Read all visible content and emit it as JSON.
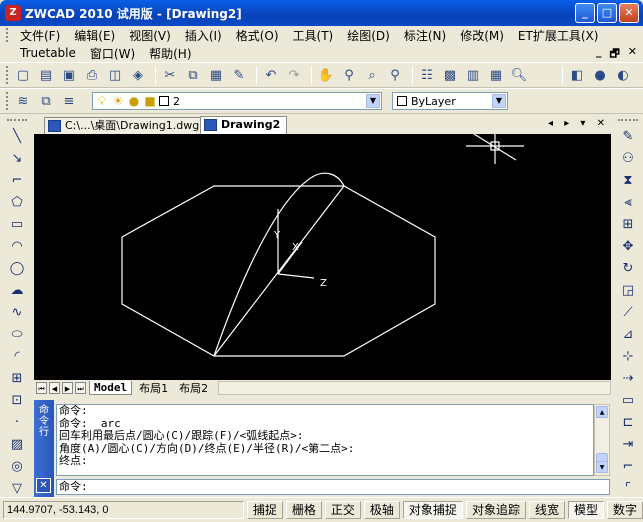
{
  "window": {
    "title": "ZWCAD 2010 试用版 - [Drawing2]",
    "app_icon": "Z",
    "buttons": {
      "minimize": "_",
      "maximize": "□",
      "close": "✕"
    }
  },
  "menubar": {
    "row1": [
      "文件(F)",
      "编辑(E)",
      "视图(V)",
      "插入(I)",
      "格式(O)",
      "工具(T)",
      "绘图(D)",
      "标注(N)",
      "修改(M)",
      "ET扩展工具(X)"
    ],
    "row2": [
      "Truetable",
      "窗口(W)",
      "帮助(H)"
    ],
    "mdi_buttons": {
      "minimize": "_",
      "restore": "🗗",
      "close": "✕"
    }
  },
  "layer_toolbar": {
    "layer_name": "2",
    "color_value": "ByLayer"
  },
  "doc_tabs": [
    {
      "label": "C:\\...\\桌面\\Drawing1.dwg",
      "active": false
    },
    {
      "label": "Drawing2",
      "active": true
    }
  ],
  "doc_tab_nav": "◂ ▸ ▾ ✕",
  "canvas": {
    "ucs_labels": {
      "y": "Y",
      "x": "X",
      "z": "Z"
    }
  },
  "layout_tabs": [
    {
      "label": "Model",
      "active": true
    },
    {
      "label": "布局1",
      "active": false
    },
    {
      "label": "布局2",
      "active": false
    }
  ],
  "command": {
    "side_label": "命令行",
    "history": [
      "命令:",
      "命令: _arc",
      "回车利用最后点/圆心(C)/跟踪(F)/<弧线起点>:",
      "角度(A)/圆心(C)/方向(D)/终点(E)/半径(R)/<第二点>:",
      "终点:"
    ],
    "prompt": "命令:"
  },
  "statusbar": {
    "coords": "144.9707,  -53.143,  0",
    "toggles": [
      {
        "label": "捕捉",
        "pressed": false
      },
      {
        "label": "栅格",
        "pressed": false
      },
      {
        "label": "正交",
        "pressed": false
      },
      {
        "label": "极轴",
        "pressed": false
      },
      {
        "label": "对象捕捉",
        "pressed": true
      },
      {
        "label": "对象追踪",
        "pressed": false
      },
      {
        "label": "线宽",
        "pressed": false
      },
      {
        "label": "模型",
        "pressed": true
      },
      {
        "label": "数字",
        "pressed": false
      }
    ]
  },
  "colors": {
    "titlebar": "#0842B8",
    "canvas_bg": "#000000",
    "geometry": "#FFFFFF",
    "chrome": "#ECE9D8"
  }
}
